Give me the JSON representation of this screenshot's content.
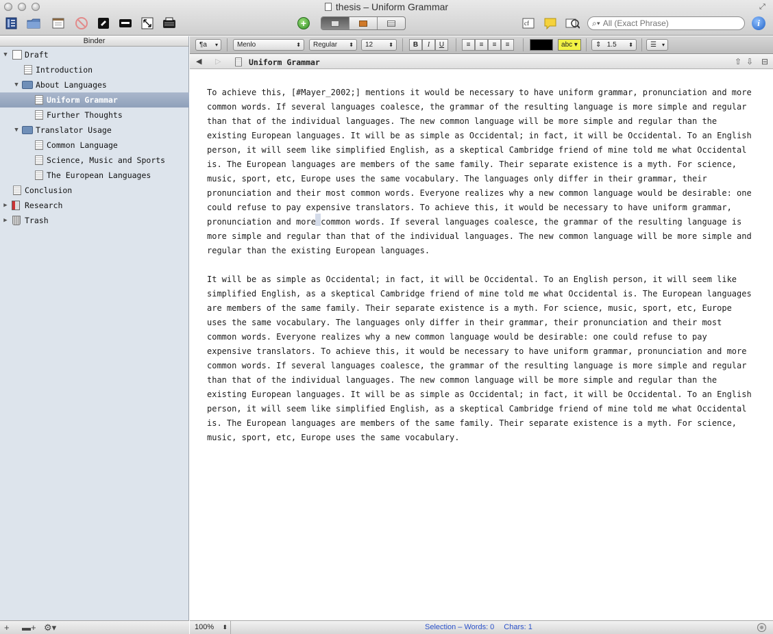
{
  "window": {
    "title": "thesis – Uniform Grammar"
  },
  "toolbar": {
    "icons": [
      "binder-toggle-icon",
      "folder-icon",
      "inspector-collection-icon",
      "no-entry-icon",
      "composition-icon",
      "keywords-icon",
      "resize-icon",
      "typewriter-icon",
      "add-icon",
      "comments-icon",
      "annotation-note-icon",
      "quick-reference-icon",
      "info-icon"
    ],
    "cf_label": "cf",
    "search_placeholder": "All (Exact Phrase)",
    "info_label": "i",
    "add_label": "+"
  },
  "binder": {
    "header": "Binder",
    "items": [
      {
        "label": "Draft",
        "icon": "draft-icon",
        "expanded": true
      },
      {
        "label": "Introduction",
        "icon": "document-icon"
      },
      {
        "label": "About Languages",
        "icon": "folder-icon",
        "expanded": true
      },
      {
        "label": "Uniform Grammar",
        "icon": "document-icon",
        "selected": true
      },
      {
        "label": "Further Thoughts",
        "icon": "document-icon"
      },
      {
        "label": "Translator Usage",
        "icon": "folder-icon",
        "expanded": true
      },
      {
        "label": "Common Language",
        "icon": "document-icon"
      },
      {
        "label": "Science, Music and Sports",
        "icon": "document-icon"
      },
      {
        "label": "The European Languages",
        "icon": "document-icon"
      },
      {
        "label": "Conclusion",
        "icon": "document-icon"
      },
      {
        "label": "Research",
        "icon": "research-icon",
        "expanded": false
      },
      {
        "label": "Trash",
        "icon": "trash-icon",
        "expanded": false
      }
    ],
    "footer": {
      "add": "+",
      "add_folder": "▬+",
      "settings": "⚙▾"
    }
  },
  "formatbar": {
    "style": "¶a",
    "font": "Menlo",
    "weight": "Regular",
    "size": "12",
    "bold": "B",
    "italic": "I",
    "underline": "U",
    "text_color": "#000000",
    "highlight_label": "abc",
    "highlight_color": "#f2f245",
    "line_spacing": "1.5",
    "list_label": "☰"
  },
  "editor": {
    "doc_title": "Uniform Grammar",
    "paragraphs": [
      [
        "To achieve this, [#Mayer_2002;] mentions it would be necessary to have uniform grammar, pronunciation and more",
        "common words. If several languages coalesce, the grammar of the resulting language is more simple and regular",
        "than that of the individual languages. The new common language will be more simple and regular than the",
        "existing European languages. It will be as simple as Occidental; in fact, it will be Occidental. To an English",
        "person, it will seem like simplified English, as a skeptical Cambridge friend of mine told me what Occidental",
        "is. The European languages are members of the same family. Their separate existence is a myth. For science,",
        "music, sport, etc, Europe uses the same vocabulary. The languages only differ in their grammar, their",
        "pronunciation and their most common words. Everyone realizes why a new common language would be desirable: one",
        "could refuse to pay expensive translators. To achieve this, it would be necessary to have uniform grammar,",
        "pronunciation and more common words. If several languages coalesce, the grammar of the resulting language is",
        "more simple and regular than that of the individual languages. The new common language will be more simple and",
        "regular than the existing European languages."
      ],
      [
        "It will be as simple as Occidental; in fact, it will be Occidental. To an English person, it will seem like",
        "simplified English, as a skeptical Cambridge friend of mine told me what Occidental is. The European languages",
        "are members of the same family. Their separate existence is a myth. For science, music, sport, etc, Europe",
        "uses the same vocabulary. The languages only differ in their grammar, their pronunciation and their most",
        "common words. Everyone realizes why a new common language would be desirable: one could refuse to pay",
        "expensive translators. To achieve this, it would be necessary to have uniform grammar, pronunciation and more",
        "common words. If several languages coalesce, the grammar of the resulting language is more simple and regular",
        "than that of the individual languages. The new common language will be more simple and regular than the",
        "existing European languages. It will be as simple as Occidental; in fact, it will be Occidental. To an English",
        "person, it will seem like simplified English, as a skeptical Cambridge friend of mine told me what Occidental",
        "is. The European languages are members of the same family. Their separate existence is a myth. For science,",
        "music, sport, etc, Europe uses the same vocabulary."
      ]
    ]
  },
  "footer": {
    "zoom": "100%",
    "selection_words": "Selection – Words: 0",
    "chars": "Chars: 1"
  }
}
